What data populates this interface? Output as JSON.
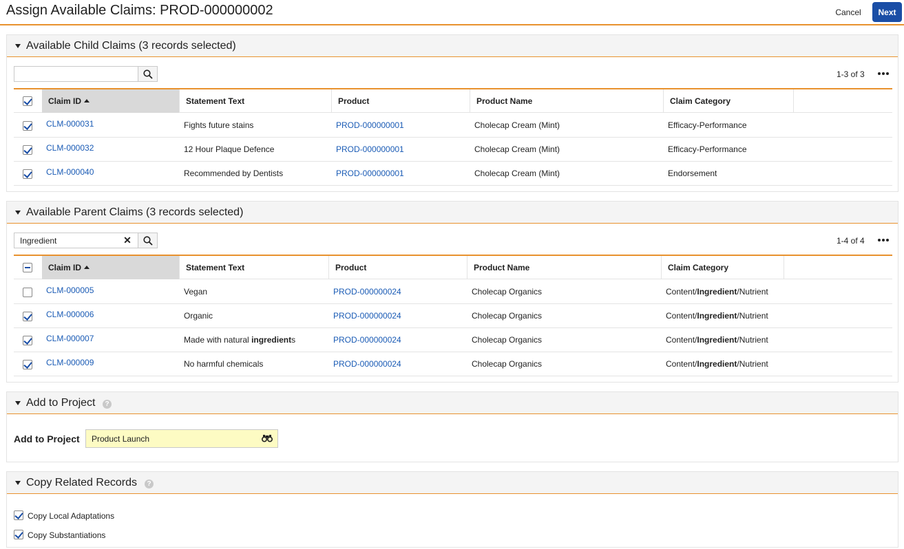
{
  "header": {
    "title": "Assign Available Claims: PROD-000000002",
    "cancel_label": "Cancel",
    "next_label": "Next"
  },
  "child_claims": {
    "title": "Available Child Claims (3 records selected)",
    "search_value": "",
    "pager": "1-3 of 3",
    "columns": [
      "Claim ID",
      "Statement Text",
      "Product",
      "Product Name",
      "Claim Category"
    ],
    "rows": [
      {
        "id": "CLM-000031",
        "statement": "Fights future stains",
        "product": "PROD-000000001",
        "product_name": "Cholecap Cream (Mint)",
        "category": "Efficacy-Performance",
        "checked": true
      },
      {
        "id": "CLM-000032",
        "statement": "12 Hour Plaque Defence",
        "product": "PROD-000000001",
        "product_name": "Cholecap Cream (Mint)",
        "category": "Efficacy-Performance",
        "checked": true
      },
      {
        "id": "CLM-000040",
        "statement": "Recommended by Dentists",
        "product": "PROD-000000001",
        "product_name": "Cholecap Cream (Mint)",
        "category": "Endorsement",
        "checked": true
      }
    ]
  },
  "parent_claims": {
    "title": "Available Parent Claims (3 records selected)",
    "search_value": "Ingredient",
    "pager": "1-4 of 4",
    "columns": [
      "Claim ID",
      "Statement Text",
      "Product",
      "Product Name",
      "Claim Category"
    ],
    "category_parts": [
      "Content/",
      "Ingredient",
      "/Nutrient"
    ],
    "rows": [
      {
        "id": "CLM-000005",
        "statement": "Vegan",
        "product": "PROD-000000024",
        "product_name": "Cholecap Organics",
        "checked": false
      },
      {
        "id": "CLM-000006",
        "statement": "Organic",
        "product": "PROD-000000024",
        "product_name": "Cholecap Organics",
        "checked": true
      },
      {
        "id": "CLM-000007",
        "statement": "Made with natural ",
        "statement_bold": "ingredient",
        "statement_after": "s",
        "product": "PROD-000000024",
        "product_name": "Cholecap Organics",
        "checked": true
      },
      {
        "id": "CLM-000009",
        "statement": "No harmful chemicals",
        "product": "PROD-000000024",
        "product_name": "Cholecap Organics",
        "checked": true
      }
    ]
  },
  "add_to_project": {
    "title": "Add to Project",
    "label": "Add to Project",
    "value": "Product Launch"
  },
  "copy_related": {
    "title": "Copy Related Records",
    "options": [
      {
        "label": "Copy Local Adaptations",
        "checked": true
      },
      {
        "label": "Copy Substantiations",
        "checked": true
      }
    ]
  },
  "help_glyph": "?",
  "clear_glyph": "✕",
  "colors": {
    "accent": "#e8912d",
    "primary": "#1a4ea6",
    "link": "#1a5bb5",
    "lookup_bg": "#fdfbc3"
  },
  "icons": [
    "search-icon",
    "clear-icon",
    "more-options-icon",
    "help-icon",
    "binoculars-icon",
    "collapse-caret-icon",
    "sort-ascending-icon"
  ]
}
